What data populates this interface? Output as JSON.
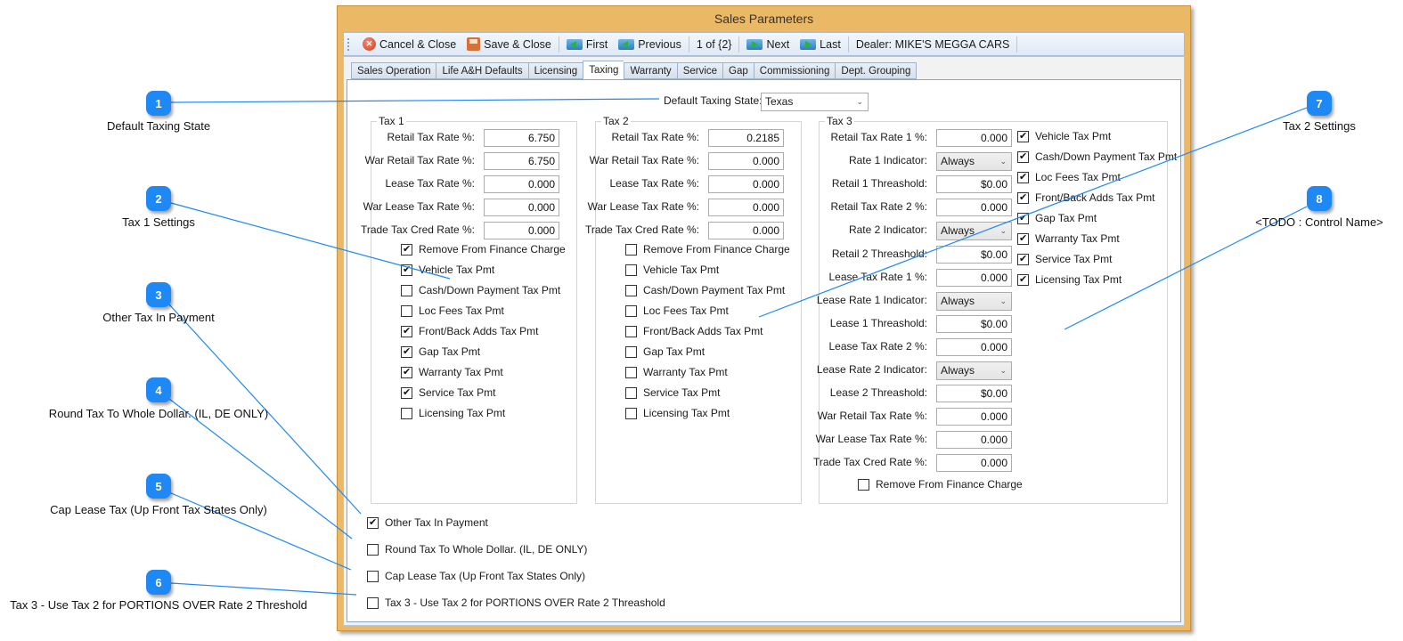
{
  "window": {
    "title": "Sales Parameters"
  },
  "toolbar": {
    "cancel_close": "Cancel & Close",
    "save_close": "Save & Close",
    "first": "First",
    "previous": "Previous",
    "record_position": "1 of {2}",
    "next": "Next",
    "last": "Last",
    "dealer": "Dealer: MIKE'S MEGGA CARS"
  },
  "tabs": [
    {
      "label": "Sales Operation",
      "active": false
    },
    {
      "label": "Life A&H Defaults",
      "active": false
    },
    {
      "label": "Licensing",
      "active": false
    },
    {
      "label": "Taxing",
      "active": true
    },
    {
      "label": "Warranty",
      "active": false
    },
    {
      "label": "Service",
      "active": false
    },
    {
      "label": "Gap",
      "active": false
    },
    {
      "label": "Commissioning",
      "active": false
    },
    {
      "label": "Dept. Grouping",
      "active": false
    }
  ],
  "default_state": {
    "label": "Default Taxing State:",
    "value": "Texas"
  },
  "tax1": {
    "title": "Tax 1",
    "fields": [
      {
        "label": "Retail Tax Rate %:",
        "value": "6.750"
      },
      {
        "label": "War Retail Tax  Rate %:",
        "value": "6.750"
      },
      {
        "label": "Lease Tax Rate %:",
        "value": "0.000"
      },
      {
        "label": "War Lease Tax Rate %:",
        "value": "0.000"
      },
      {
        "label": "Trade Tax Cred Rate %:",
        "value": "0.000"
      }
    ],
    "checks": [
      {
        "label": "Remove From Finance Charge",
        "checked": true
      },
      {
        "label": "Vehicle Tax Pmt",
        "checked": true
      },
      {
        "label": "Cash/Down Payment Tax Pmt",
        "checked": false
      },
      {
        "label": "Loc Fees Tax Pmt",
        "checked": false
      },
      {
        "label": "Front/Back Adds Tax Pmt",
        "checked": true
      },
      {
        "label": "Gap Tax Pmt",
        "checked": true
      },
      {
        "label": "Warranty Tax Pmt",
        "checked": true
      },
      {
        "label": "Service Tax Pmt",
        "checked": true
      },
      {
        "label": "Licensing Tax Pmt",
        "checked": false
      }
    ]
  },
  "tax2": {
    "title": "Tax 2",
    "fields": [
      {
        "label": "Retail Tax Rate %:",
        "value": "0.2185"
      },
      {
        "label": "War Retail Tax  Rate %:",
        "value": "0.000"
      },
      {
        "label": "Lease Tax Rate %:",
        "value": "0.000"
      },
      {
        "label": "War Lease Tax Rate %:",
        "value": "0.000"
      },
      {
        "label": "Trade Tax Cred Rate %:",
        "value": "0.000"
      }
    ],
    "checks": [
      {
        "label": "Remove From Finance Charge",
        "checked": false
      },
      {
        "label": "Vehicle Tax Pmt",
        "checked": false
      },
      {
        "label": "Cash/Down Payment Tax Pmt",
        "checked": false
      },
      {
        "label": "Loc Fees Tax Pmt",
        "checked": false
      },
      {
        "label": "Front/Back Adds Tax Pmt",
        "checked": false
      },
      {
        "label": "Gap Tax Pmt",
        "checked": false
      },
      {
        "label": "Warranty Tax Pmt",
        "checked": false
      },
      {
        "label": "Service Tax Pmt",
        "checked": false
      },
      {
        "label": "Licensing Tax Pmt",
        "checked": false
      }
    ]
  },
  "tax3": {
    "title": "Tax 3",
    "fields": [
      {
        "label": "Retail Tax Rate 1 %:",
        "value": "0.000",
        "type": "input"
      },
      {
        "label": "Rate 1 Indicator:",
        "value": "Always",
        "type": "select"
      },
      {
        "label": "Retail 1 Threashold:",
        "value": "$0.00",
        "type": "input"
      },
      {
        "label": "Retail Tax Rate 2 %:",
        "value": "0.000",
        "type": "input"
      },
      {
        "label": "Rate 2 Indicator:",
        "value": "Always",
        "type": "select"
      },
      {
        "label": "Retail 2 Threashold:",
        "value": "$0.00",
        "type": "input"
      },
      {
        "label": "Lease Tax Rate 1 %:",
        "value": "0.000",
        "type": "input"
      },
      {
        "label": "Lease Rate 1 Indicator:",
        "value": "Always",
        "type": "select"
      },
      {
        "label": "Lease 1 Threashold:",
        "value": "$0.00",
        "type": "input"
      },
      {
        "label": "Lease Tax Rate 2 %:",
        "value": "0.000",
        "type": "input"
      },
      {
        "label": "Lease Rate 2 Indicator:",
        "value": "Always",
        "type": "select"
      },
      {
        "label": "Lease 2 Threashold:",
        "value": "$0.00",
        "type": "input"
      },
      {
        "label": "War Retail Tax  Rate %:",
        "value": "0.000",
        "type": "input"
      },
      {
        "label": "War Lease Tax Rate %:",
        "value": "0.000",
        "type": "input"
      },
      {
        "label": "Trade Tax Cred Rate %:",
        "value": "0.000",
        "type": "input"
      }
    ],
    "remove_finance": {
      "label": "Remove From Finance Charge",
      "checked": false
    },
    "checks": [
      {
        "label": "Vehicle Tax Pmt",
        "checked": true
      },
      {
        "label": "Cash/Down Payment Tax Pmt",
        "checked": true
      },
      {
        "label": "Loc Fees Tax Pmt",
        "checked": true
      },
      {
        "label": "Front/Back Adds Tax Pmt",
        "checked": true
      },
      {
        "label": "Gap Tax Pmt",
        "checked": true
      },
      {
        "label": "Warranty Tax Pmt",
        "checked": true
      },
      {
        "label": "Service Tax Pmt",
        "checked": true
      },
      {
        "label": "Licensing Tax Pmt",
        "checked": true
      }
    ]
  },
  "bottom_checks": [
    {
      "label": "Other Tax In Payment",
      "checked": true
    },
    {
      "label": "Round Tax To Whole Dollar. (IL, DE ONLY)",
      "checked": false
    },
    {
      "label": "Cap Lease Tax (Up Front Tax States Only)",
      "checked": false
    },
    {
      "label": "Tax 3 - Use Tax 2 for PORTIONS OVER Rate 2 Threashold",
      "checked": false
    }
  ],
  "callouts": [
    {
      "number": "1",
      "label": "Default Taxing State"
    },
    {
      "number": "2",
      "label": "Tax 1 Settings"
    },
    {
      "number": "3",
      "label": "Other Tax In Payment"
    },
    {
      "number": "4",
      "label": "Round Tax To Whole Dollar. (IL, DE ONLY)"
    },
    {
      "number": "5",
      "label": "Cap Lease Tax (Up Front Tax States Only)"
    },
    {
      "number": "6",
      "label": "Tax 3 - Use Tax 2 for PORTIONS OVER Rate 2 Threshold"
    },
    {
      "number": "7",
      "label": "Tax 2 Settings"
    },
    {
      "number": "8",
      "label": "<TODO : Control Name>"
    }
  ],
  "colors": {
    "callout": "#1e88f5",
    "window_frame": "#ebb866"
  }
}
